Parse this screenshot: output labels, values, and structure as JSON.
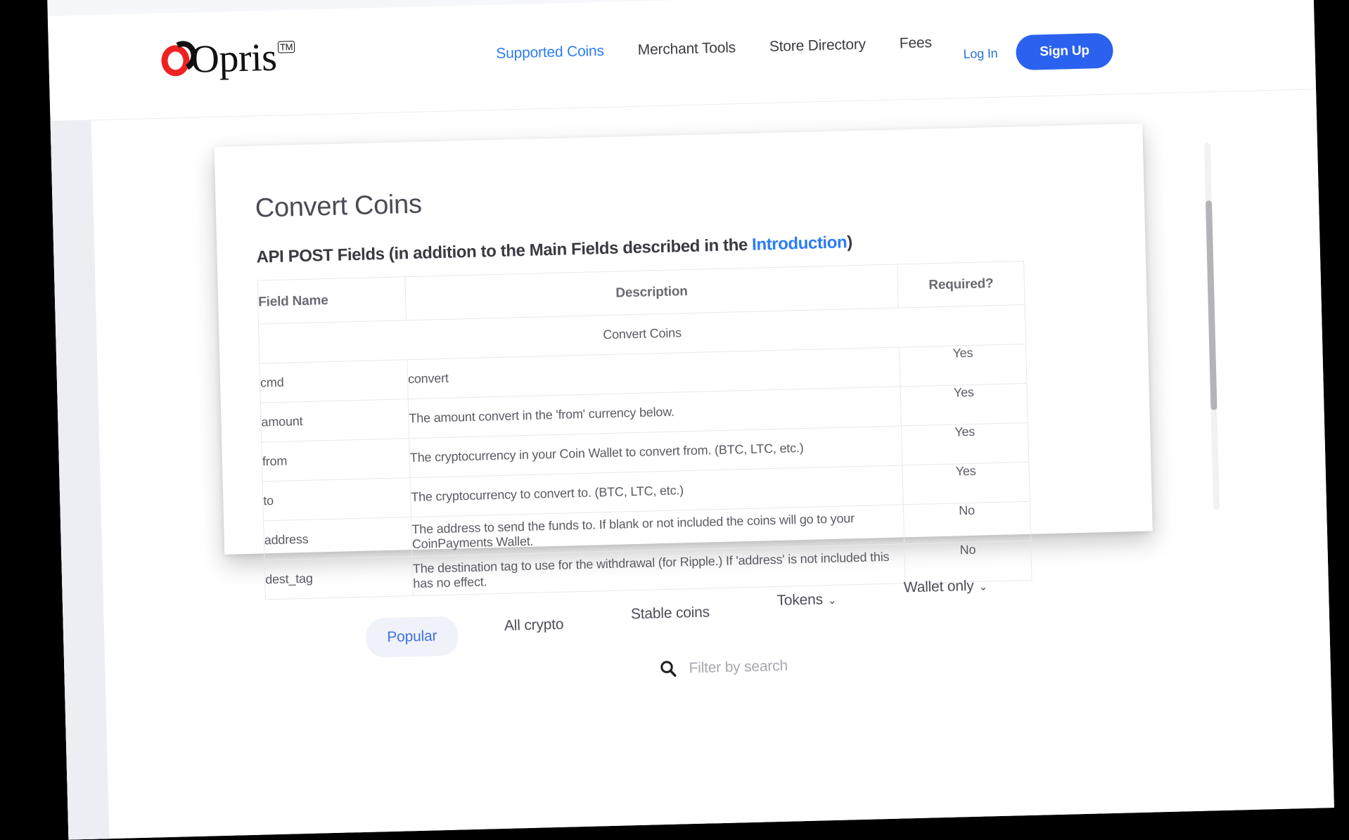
{
  "brand": {
    "name": "Opris",
    "tm": "TM"
  },
  "nav": {
    "items": [
      {
        "label": "Supported Coins",
        "active": true
      },
      {
        "label": "Merchant Tools",
        "active": false
      },
      {
        "label": "Store Directory",
        "active": false
      },
      {
        "label": "Fees",
        "active": false
      }
    ],
    "login_label": "Log In",
    "signup_label": "Sign Up"
  },
  "doc": {
    "title": "Convert Coins",
    "subtitle_before": "API POST Fields (in addition to the Main Fields described in the ",
    "subtitle_link": "Introduction",
    "subtitle_after": ")",
    "table": {
      "headers": {
        "field": "Field Name",
        "description": "Description",
        "required": "Required?"
      },
      "section_label": "Convert Coins",
      "rows": [
        {
          "field": "cmd",
          "description": "convert",
          "required": "Yes"
        },
        {
          "field": "amount",
          "description": "The amount convert in the 'from' currency below.",
          "required": "Yes"
        },
        {
          "field": "from",
          "description": "The cryptocurrency in your Coin Wallet to convert from. (BTC, LTC, etc.)",
          "required": "Yes"
        },
        {
          "field": "to",
          "description": "The cryptocurrency to convert to. (BTC, LTC, etc.)",
          "required": "Yes"
        },
        {
          "field": "address",
          "description": "The address to send the funds to. If blank or not included the coins will go to your CoinPayments Wallet.",
          "required": "No"
        },
        {
          "field": "dest_tag",
          "description": "The destination tag to use for the withdrawal (for Ripple.) If 'address' is not included this has no effect.",
          "required": "No"
        }
      ]
    }
  },
  "filters": {
    "tabs": [
      {
        "label": "Popular",
        "active": true,
        "chevron": false
      },
      {
        "label": "All crypto",
        "active": false,
        "chevron": false
      },
      {
        "label": "Stable coins",
        "active": false,
        "chevron": false
      },
      {
        "label": "Tokens",
        "active": false,
        "chevron": true
      },
      {
        "label": "Wallet only",
        "active": false,
        "chevron": true
      }
    ],
    "chevron_glyph": "⌄",
    "search_placeholder": "Filter by search",
    "search_value": ""
  },
  "colors": {
    "accent_blue": "#2a62ef",
    "link_blue": "#2b7cf6",
    "logo_red": "#ef2222",
    "page_bg": "#ffffff",
    "rail_bg": "#eceef4"
  }
}
